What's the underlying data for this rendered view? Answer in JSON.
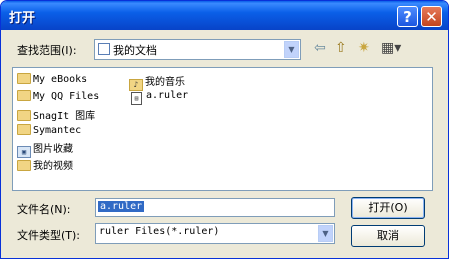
{
  "window": {
    "title": "打开",
    "help_glyph": "?",
    "close_glyph": "✕"
  },
  "lookin": {
    "label": "查找范围(I):",
    "value": "我的文档"
  },
  "toolbar": {
    "back": "⇦",
    "up": "⇧",
    "newfolder": "✷",
    "views": "▦▾"
  },
  "files": [
    {
      "name": "My eBooks",
      "icon": "folder-icon"
    },
    {
      "name": "My QQ Files",
      "icon": "folder-icon"
    },
    {
      "name": "SnagIt 图库",
      "icon": "folder-icon"
    },
    {
      "name": "Symantec",
      "icon": "folder-icon"
    },
    {
      "name": "图片收藏",
      "icon": "pictures-folder-icon"
    },
    {
      "name": "我的视频",
      "icon": "folder-icon"
    },
    {
      "name": "我的音乐",
      "icon": "music-folder-icon"
    },
    {
      "name": "a.ruler",
      "icon": "file-icon"
    }
  ],
  "filename": {
    "label": "文件名(N):",
    "value": "a.ruler"
  },
  "filetype": {
    "label": "文件类型(T):",
    "value": "ruler Files(*.ruler)"
  },
  "buttons": {
    "open": "打开(O)",
    "cancel": "取消"
  },
  "colors": {
    "titlebar": "#0a5fe8",
    "dialog_bg": "#ece9d8",
    "selection": "#316ac5"
  }
}
